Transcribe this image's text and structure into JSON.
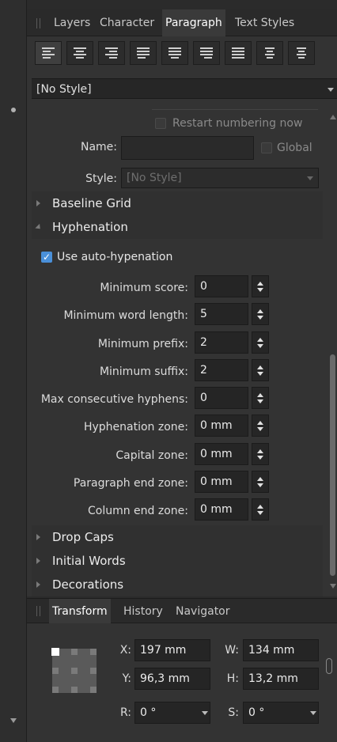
{
  "top_tabs": [
    "Layers",
    "Character",
    "Paragraph",
    "Text Styles"
  ],
  "active_top_tab": "Paragraph",
  "alignment_buttons": [
    {
      "name": "align-left-icon",
      "selected": true
    },
    {
      "name": "align-center-icon",
      "selected": false
    },
    {
      "name": "align-right-icon",
      "selected": false
    },
    {
      "name": "justify-left-icon",
      "selected": false
    },
    {
      "name": "justify-center-icon",
      "selected": false
    },
    {
      "name": "justify-right-icon",
      "selected": false
    },
    {
      "name": "justify-all-icon",
      "selected": false
    },
    {
      "name": "align-towards-spine-icon",
      "selected": false
    },
    {
      "name": "align-away-spine-icon",
      "selected": false
    }
  ],
  "paragraph_style": "[No Style]",
  "numbering": {
    "restart_label": "Restart numbering now",
    "name_label": "Name:",
    "name_value": "",
    "global_label": "Global",
    "style_label": "Style:",
    "style_value": "[No Style]"
  },
  "sections": {
    "baseline_grid": "Baseline Grid",
    "hyphenation": "Hyphenation",
    "drop_caps": "Drop Caps",
    "initial_words": "Initial Words",
    "decorations": "Decorations"
  },
  "hyphenation": {
    "auto_label": "Use auto-hypenation",
    "auto_checked": true,
    "fields": [
      {
        "label": "Minimum score:",
        "value": "0"
      },
      {
        "label": "Minimum word length:",
        "value": "5"
      },
      {
        "label": "Minimum prefix:",
        "value": "2"
      },
      {
        "label": "Minimum suffix:",
        "value": "2"
      },
      {
        "label": "Max consecutive hyphens:",
        "value": "0"
      },
      {
        "label": "Hyphenation zone:",
        "value": "0 mm"
      },
      {
        "label": "Capital zone:",
        "value": "0 mm"
      },
      {
        "label": "Paragraph end zone:",
        "value": "0 mm"
      },
      {
        "label": "Column end zone:",
        "value": "0 mm"
      }
    ]
  },
  "bottom_tabs": [
    "Transform",
    "History",
    "Navigator"
  ],
  "active_bottom_tab": "Transform",
  "transform": {
    "x_label": "X:",
    "x_value": "197 mm",
    "y_label": "Y:",
    "y_value": "96,3 mm",
    "w_label": "W:",
    "w_value": "134 mm",
    "h_label": "H:",
    "h_value": "13,2 mm",
    "r_label": "R:",
    "r_value": "0 °",
    "s_label": "S:",
    "s_value": "0 °"
  },
  "colors": {
    "accent": "#4a90d9",
    "panel": "#333333",
    "field": "#252525"
  }
}
